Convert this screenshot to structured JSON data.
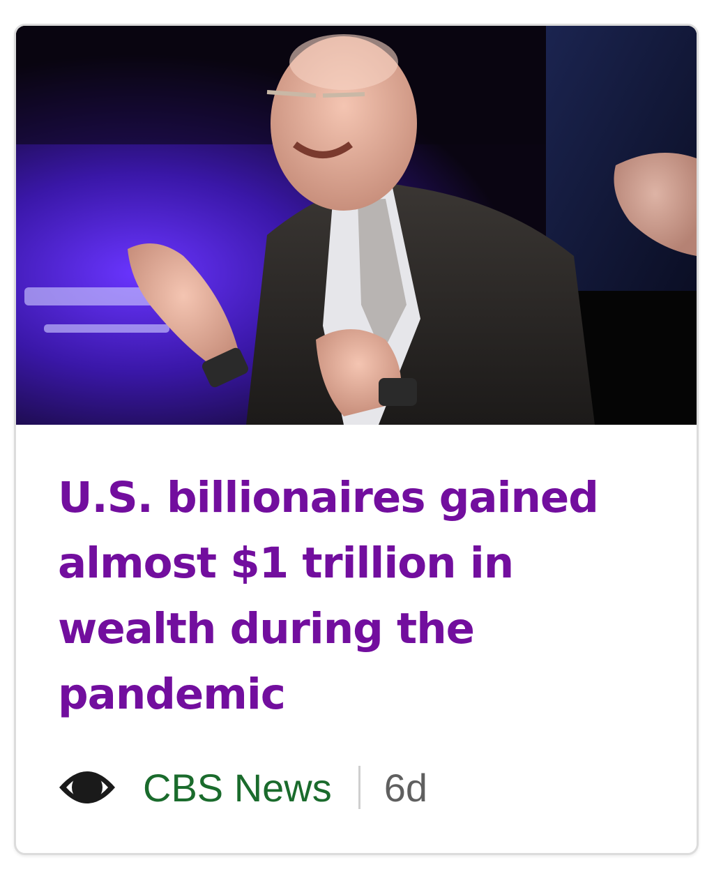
{
  "story": {
    "headline": "U.S. billionaires gained almost $1 trillion in wealth during the pandemic",
    "provider": {
      "name": "CBS News",
      "logo_icon": "cbs-eye-logo-icon"
    },
    "age": "6d",
    "image": {
      "semantic": "news-photo"
    }
  },
  "colors": {
    "headline": "#720e9e",
    "provider": "#1a6b2c",
    "age": "#5f5f5f",
    "border": "#dcdcdc"
  }
}
